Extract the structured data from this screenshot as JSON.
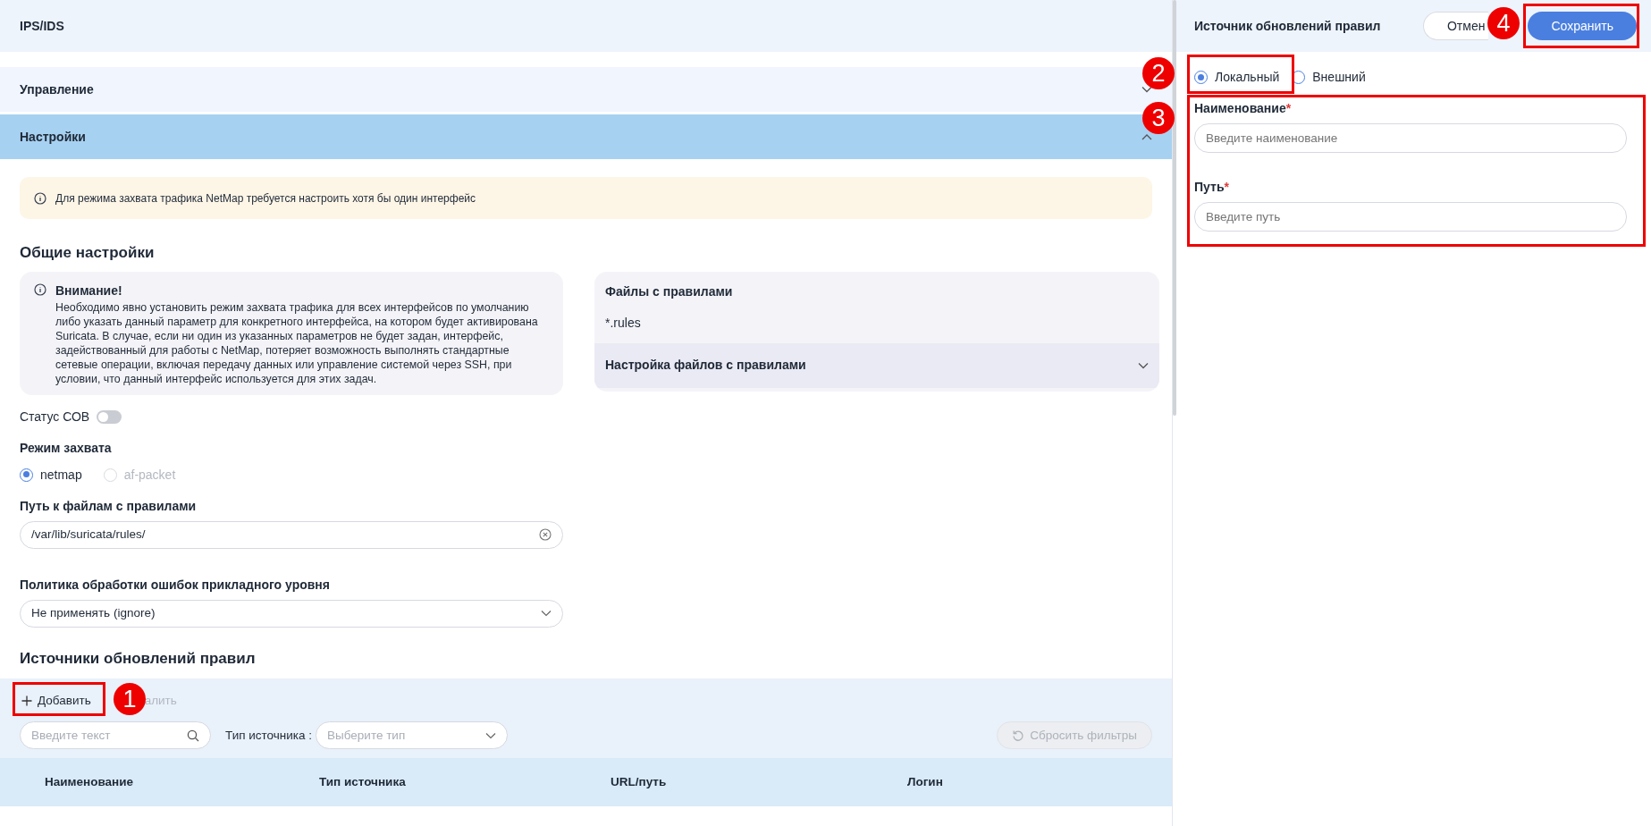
{
  "header": {
    "title": "IPS/IDS"
  },
  "sections": [
    {
      "title": "Управление",
      "expanded": false
    },
    {
      "title": "Настройки",
      "expanded": true
    }
  ],
  "notice": "Для режима захвата трафика NetMap требуется настроить хотя бы один интерфейс",
  "general": {
    "title": "Общие настройки",
    "attention": {
      "title": "Внимание!",
      "text": "Необходимо явно установить режим захвата трафика для всех интерфейсов по умолчанию либо указать данный параметр для конкретного интерфейса, на котором будет активирована Suricata. В случае, если ни один из указанных параметров не будет задан, интерфейс, задействованный для работы с NetMap, потеряет возможность выполнять стандартные сетевые операции, включая передачу данных или управление системой через SSH, при условии, что данный интерфейс используется для этих задач."
    },
    "status": {
      "label": "Статус СОВ",
      "on": false
    },
    "capture": {
      "label": "Режим захвата",
      "options": [
        {
          "label": "netmap",
          "selected": true,
          "disabled": false
        },
        {
          "label": "af-packet",
          "selected": false,
          "disabled": true
        }
      ]
    },
    "rules_path": {
      "label": "Путь к файлам с правилами",
      "value": "/var/lib/suricata/rules/"
    },
    "error_policy": {
      "label": "Политика обработки ошибок прикладного уровня",
      "value": "Не применять (ignore)"
    }
  },
  "rule_files": {
    "title": "Файлы с правилами",
    "value": "*.rules",
    "settings": {
      "title": "Настройка файлов с правилами",
      "expanded": false
    }
  },
  "sources": {
    "title": "Источники обновлений правил",
    "actions": [
      {
        "label": "Добавить",
        "kind": "add",
        "disabled": false
      },
      {
        "label": "алить",
        "kind": "delete",
        "disabled": true
      }
    ],
    "search": {
      "placeholder": "Введите текст"
    },
    "type_filter": {
      "label": "Тип источника :",
      "placeholder": "Выберите тип"
    },
    "reset": {
      "label": "Сбросить фильтры",
      "disabled": true
    },
    "table": {
      "columns": [
        "Наименование",
        "Тип источника",
        "URL/путь",
        "Логин"
      ]
    }
  },
  "drawer": {
    "title": "Источник обновлений правил",
    "cancel": "Отмен",
    "save": "Сохранить",
    "source_types": [
      {
        "label": "Локальный",
        "selected": true
      },
      {
        "label": "Внешний",
        "selected": false
      }
    ],
    "fields": [
      {
        "label": "Наименование",
        "required_mark": "*",
        "placeholder": "Введите наименование"
      },
      {
        "label": "Путь",
        "required_mark": "*",
        "placeholder": "Введите путь"
      }
    ]
  },
  "annotations": [
    {
      "number": "1"
    },
    {
      "number": "2"
    },
    {
      "number": "3"
    },
    {
      "number": "4"
    }
  ]
}
